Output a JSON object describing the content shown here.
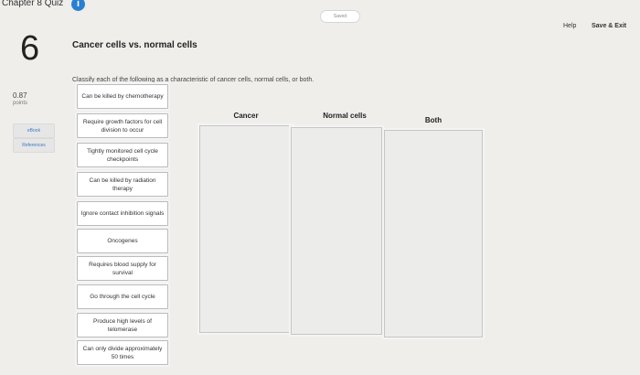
{
  "header": {
    "quiz_title": "Chapter 8 Quiz",
    "info_icon_glyph": "i",
    "saved_status": "Saved",
    "help_label": "Help",
    "save_exit_label": "Save & Exit"
  },
  "question": {
    "number": "6",
    "points_value": "0.87",
    "points_label": "points",
    "title": "Cancer cells vs. normal cells",
    "instructions": "Classify each of the following as a characteristic of cancer cells, normal cells, or both."
  },
  "resources": {
    "ebook_label": "eBook",
    "references_label": "References"
  },
  "cards": [
    "Can be killed by chemotherapy",
    "Require growth factors for cell division to occur",
    "Tightly monitored cell cycle checkpoints",
    "Can be killed by radiation therapy",
    "Ignore contact inhibition signals",
    "Oncogenes",
    "Requires blood supply for survival",
    "Go through the cell cycle",
    "Produce high levels of telomerase",
    "Can only divide approximately 50 times"
  ],
  "columns": [
    "Cancer",
    "Normal cells",
    "Both"
  ],
  "colors": {
    "accent": "#2b7fd2",
    "link": "#3a78c3",
    "background": "#efeeeb"
  }
}
